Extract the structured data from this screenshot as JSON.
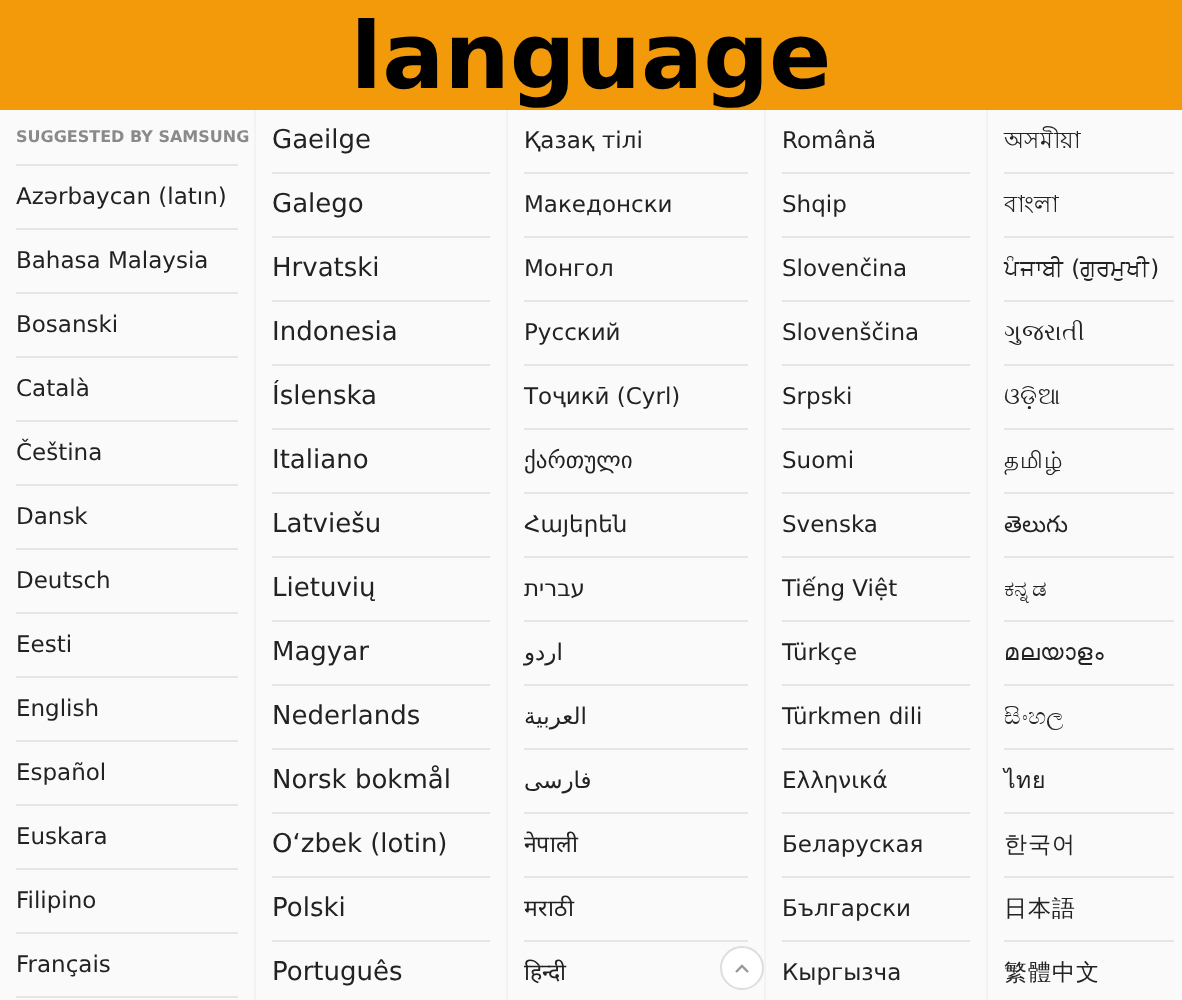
{
  "banner": {
    "title": "language"
  },
  "columns": [
    {
      "header": "SUGGESTED BY SAMSUNG",
      "items": [
        "Azərbaycan (latın)",
        "Bahasa Malaysia",
        "Bosanski",
        "Català",
        "Čeština",
        "Dansk",
        "Deutsch",
        "Eesti",
        "English",
        "Español",
        "Euskara",
        "Filipino",
        "Français"
      ]
    },
    {
      "items": [
        "Gaeilge",
        "Galego",
        "Hrvatski",
        "Indonesia",
        "Íslenska",
        "Italiano",
        "Latviešu",
        "Lietuvių",
        "Magyar",
        "Nederlands",
        "Norsk bokmål",
        "O‘zbek (lotin)",
        "Polski",
        "Português"
      ]
    },
    {
      "items": [
        "Қазақ тілі",
        "Македонски",
        "Монгол",
        "Русский",
        "Тоҷикӣ (Cyrl)",
        "ქართული",
        "Հայերեն",
        "עברית",
        "اردو",
        "العربية",
        "فارسی",
        "नेपाली",
        "मराठी",
        "हिन्दी"
      ]
    },
    {
      "items": [
        "Română",
        "Shqip",
        "Slovenčina",
        "Slovenščina",
        "Srpski",
        "Suomi",
        "Svenska",
        "Tiếng Việt",
        "Türkçe",
        "Türkmen dili",
        "Ελληνικά",
        "Беларуская",
        "Български",
        "Кыргызча"
      ]
    },
    {
      "items": [
        "অসমীয়া",
        "বাংলা",
        "ਪੰਜਾਬੀ (ਗੁਰਮੁਖੀ)",
        "ગુજરાતી",
        "ଓଡ଼ିଆ",
        "தமிழ்",
        "తెలుగు",
        "ಕನ್ನಡ",
        "മലയാളം",
        "සිංහල",
        "ไทย",
        "한국어",
        "日本語",
        "繁體中文"
      ]
    }
  ]
}
